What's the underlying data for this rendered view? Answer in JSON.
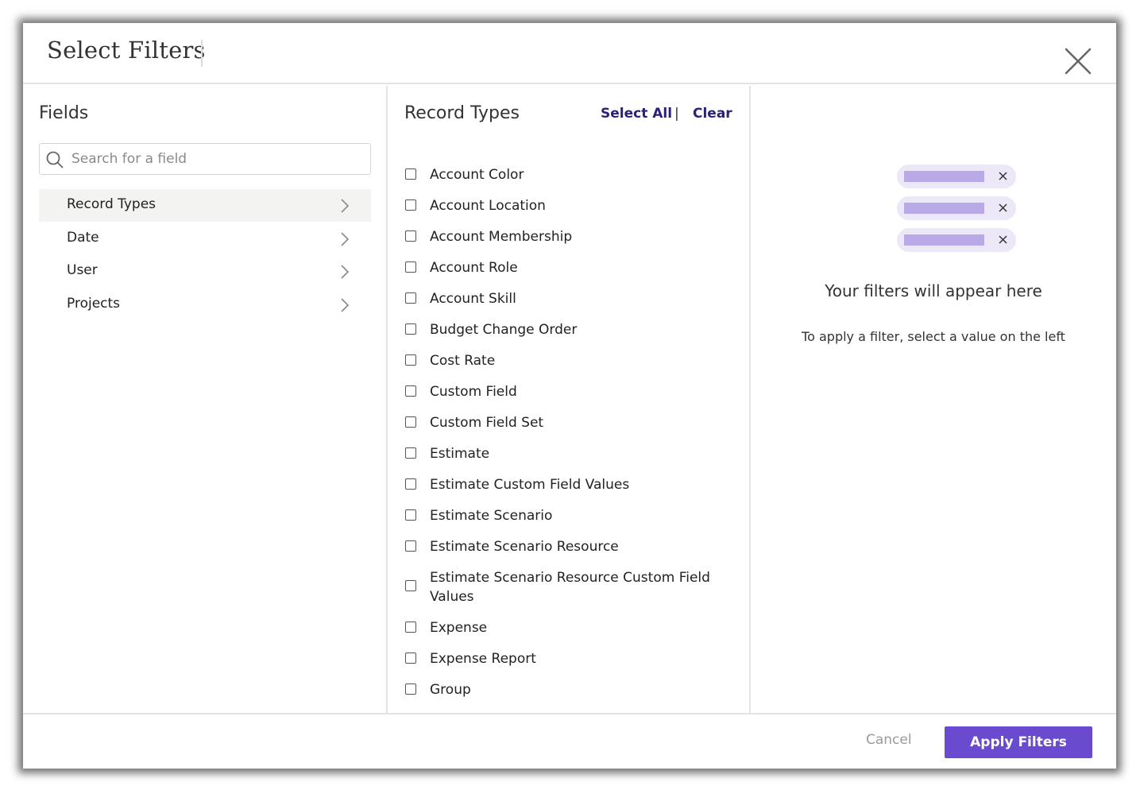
{
  "modal": {
    "title": "Select Filters"
  },
  "fields_panel": {
    "heading": "Fields",
    "search_placeholder": "Search for a field",
    "items": [
      {
        "label": "Record Types",
        "active": true
      },
      {
        "label": "Date",
        "active": false
      },
      {
        "label": "User",
        "active": false
      },
      {
        "label": "Projects",
        "active": false
      }
    ]
  },
  "record_types_panel": {
    "heading": "Record Types",
    "select_all_label": "Select All",
    "separator": "|",
    "clear_label": "Clear",
    "items": [
      {
        "label": "Account Color",
        "checked": false
      },
      {
        "label": "Account Location",
        "checked": false
      },
      {
        "label": "Account Membership",
        "checked": false
      },
      {
        "label": "Account Role",
        "checked": false
      },
      {
        "label": "Account Skill",
        "checked": false
      },
      {
        "label": "Budget Change Order",
        "checked": false
      },
      {
        "label": "Cost Rate",
        "checked": false
      },
      {
        "label": "Custom Field",
        "checked": false
      },
      {
        "label": "Custom Field Set",
        "checked": false
      },
      {
        "label": "Estimate",
        "checked": false
      },
      {
        "label": "Estimate Custom Field Values",
        "checked": false
      },
      {
        "label": "Estimate Scenario",
        "checked": false
      },
      {
        "label": "Estimate Scenario Resource",
        "checked": false
      },
      {
        "label": "Estimate Scenario Resource Custom Field Values",
        "checked": false
      },
      {
        "label": "Expense",
        "checked": false
      },
      {
        "label": "Expense Report",
        "checked": false
      },
      {
        "label": "Group",
        "checked": false
      }
    ]
  },
  "applied_panel": {
    "empty_title": "Your filters will appear here",
    "empty_subtitle": "To apply a filter, select a value on the left"
  },
  "footer": {
    "cancel_label": "Cancel",
    "apply_label": "Apply Filters"
  },
  "colors": {
    "accent": "#6a4bd0",
    "link": "#2a2278",
    "chip_bg": "#ece8f7",
    "chip_bar": "#b9a9e6"
  }
}
